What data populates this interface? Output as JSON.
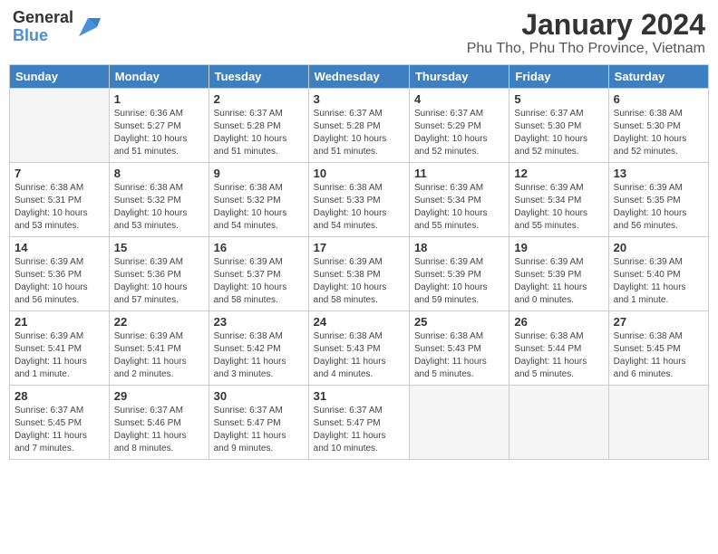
{
  "header": {
    "logo_general": "General",
    "logo_blue": "Blue",
    "title": "January 2024",
    "subtitle": "Phu Tho, Phu Tho Province, Vietnam"
  },
  "weekdays": [
    "Sunday",
    "Monday",
    "Tuesday",
    "Wednesday",
    "Thursday",
    "Friday",
    "Saturday"
  ],
  "weeks": [
    [
      {
        "day": "",
        "info": ""
      },
      {
        "day": "1",
        "info": "Sunrise: 6:36 AM\nSunset: 5:27 PM\nDaylight: 10 hours\nand 51 minutes."
      },
      {
        "day": "2",
        "info": "Sunrise: 6:37 AM\nSunset: 5:28 PM\nDaylight: 10 hours\nand 51 minutes."
      },
      {
        "day": "3",
        "info": "Sunrise: 6:37 AM\nSunset: 5:28 PM\nDaylight: 10 hours\nand 51 minutes."
      },
      {
        "day": "4",
        "info": "Sunrise: 6:37 AM\nSunset: 5:29 PM\nDaylight: 10 hours\nand 52 minutes."
      },
      {
        "day": "5",
        "info": "Sunrise: 6:37 AM\nSunset: 5:30 PM\nDaylight: 10 hours\nand 52 minutes."
      },
      {
        "day": "6",
        "info": "Sunrise: 6:38 AM\nSunset: 5:30 PM\nDaylight: 10 hours\nand 52 minutes."
      }
    ],
    [
      {
        "day": "7",
        "info": "Sunrise: 6:38 AM\nSunset: 5:31 PM\nDaylight: 10 hours\nand 53 minutes."
      },
      {
        "day": "8",
        "info": "Sunrise: 6:38 AM\nSunset: 5:32 PM\nDaylight: 10 hours\nand 53 minutes."
      },
      {
        "day": "9",
        "info": "Sunrise: 6:38 AM\nSunset: 5:32 PM\nDaylight: 10 hours\nand 54 minutes."
      },
      {
        "day": "10",
        "info": "Sunrise: 6:38 AM\nSunset: 5:33 PM\nDaylight: 10 hours\nand 54 minutes."
      },
      {
        "day": "11",
        "info": "Sunrise: 6:39 AM\nSunset: 5:34 PM\nDaylight: 10 hours\nand 55 minutes."
      },
      {
        "day": "12",
        "info": "Sunrise: 6:39 AM\nSunset: 5:34 PM\nDaylight: 10 hours\nand 55 minutes."
      },
      {
        "day": "13",
        "info": "Sunrise: 6:39 AM\nSunset: 5:35 PM\nDaylight: 10 hours\nand 56 minutes."
      }
    ],
    [
      {
        "day": "14",
        "info": "Sunrise: 6:39 AM\nSunset: 5:36 PM\nDaylight: 10 hours\nand 56 minutes."
      },
      {
        "day": "15",
        "info": "Sunrise: 6:39 AM\nSunset: 5:36 PM\nDaylight: 10 hours\nand 57 minutes."
      },
      {
        "day": "16",
        "info": "Sunrise: 6:39 AM\nSunset: 5:37 PM\nDaylight: 10 hours\nand 58 minutes."
      },
      {
        "day": "17",
        "info": "Sunrise: 6:39 AM\nSunset: 5:38 PM\nDaylight: 10 hours\nand 58 minutes."
      },
      {
        "day": "18",
        "info": "Sunrise: 6:39 AM\nSunset: 5:39 PM\nDaylight: 10 hours\nand 59 minutes."
      },
      {
        "day": "19",
        "info": "Sunrise: 6:39 AM\nSunset: 5:39 PM\nDaylight: 11 hours\nand 0 minutes."
      },
      {
        "day": "20",
        "info": "Sunrise: 6:39 AM\nSunset: 5:40 PM\nDaylight: 11 hours\nand 1 minute."
      }
    ],
    [
      {
        "day": "21",
        "info": "Sunrise: 6:39 AM\nSunset: 5:41 PM\nDaylight: 11 hours\nand 1 minute."
      },
      {
        "day": "22",
        "info": "Sunrise: 6:39 AM\nSunset: 5:41 PM\nDaylight: 11 hours\nand 2 minutes."
      },
      {
        "day": "23",
        "info": "Sunrise: 6:38 AM\nSunset: 5:42 PM\nDaylight: 11 hours\nand 3 minutes."
      },
      {
        "day": "24",
        "info": "Sunrise: 6:38 AM\nSunset: 5:43 PM\nDaylight: 11 hours\nand 4 minutes."
      },
      {
        "day": "25",
        "info": "Sunrise: 6:38 AM\nSunset: 5:43 PM\nDaylight: 11 hours\nand 5 minutes."
      },
      {
        "day": "26",
        "info": "Sunrise: 6:38 AM\nSunset: 5:44 PM\nDaylight: 11 hours\nand 5 minutes."
      },
      {
        "day": "27",
        "info": "Sunrise: 6:38 AM\nSunset: 5:45 PM\nDaylight: 11 hours\nand 6 minutes."
      }
    ],
    [
      {
        "day": "28",
        "info": "Sunrise: 6:37 AM\nSunset: 5:45 PM\nDaylight: 11 hours\nand 7 minutes."
      },
      {
        "day": "29",
        "info": "Sunrise: 6:37 AM\nSunset: 5:46 PM\nDaylight: 11 hours\nand 8 minutes."
      },
      {
        "day": "30",
        "info": "Sunrise: 6:37 AM\nSunset: 5:47 PM\nDaylight: 11 hours\nand 9 minutes."
      },
      {
        "day": "31",
        "info": "Sunrise: 6:37 AM\nSunset: 5:47 PM\nDaylight: 11 hours\nand 10 minutes."
      },
      {
        "day": "",
        "info": ""
      },
      {
        "day": "",
        "info": ""
      },
      {
        "day": "",
        "info": ""
      }
    ]
  ]
}
